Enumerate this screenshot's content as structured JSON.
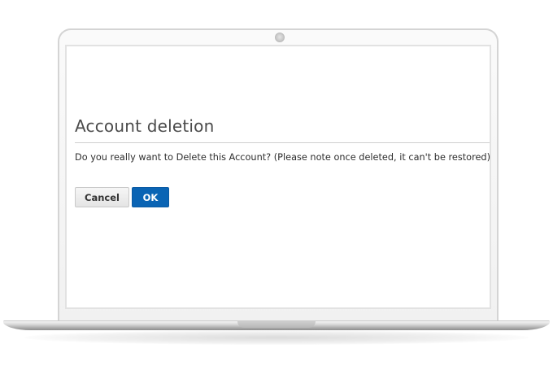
{
  "dialog": {
    "title": "Account deletion",
    "message": "Do you really want to Delete this Account? (Please note once deleted, it can't be restored)",
    "buttons": {
      "cancel_label": "Cancel",
      "ok_label": "OK"
    }
  },
  "colors": {
    "primary_button": "#0a64b4",
    "secondary_button": "#ececec",
    "title_text": "#4a4a4a",
    "body_text": "#2e2e2e"
  }
}
